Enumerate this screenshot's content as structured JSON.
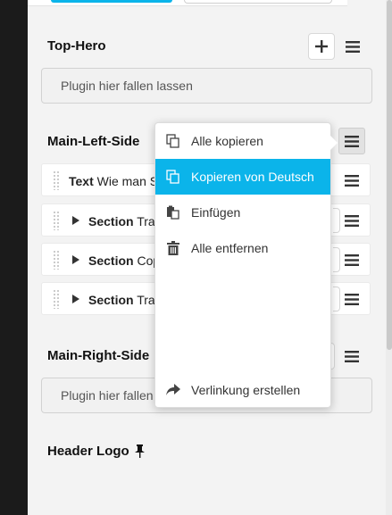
{
  "placeholders": {
    "items": []
  },
  "sections": {
    "top_hero": {
      "title": "Top-Hero",
      "dropzone": "Plugin hier fallen lassen"
    },
    "main_left": {
      "title": "Main-Left-Side",
      "rows": [
        {
          "type": "Text",
          "text": "Wie man S"
        },
        {
          "type": "Section",
          "text": "Tra"
        },
        {
          "type": "Section",
          "text": "Cop"
        },
        {
          "type": "Section",
          "text": "Tra"
        }
      ]
    },
    "main_right": {
      "title": "Main-Right-Side",
      "dropzone": "Plugin hier fallen"
    },
    "header_logo": {
      "title": "Header Logo"
    }
  },
  "dropdown": {
    "items": [
      {
        "label": "Alle kopieren",
        "icon": "copy-icon",
        "highlighted": false
      },
      {
        "label": "Kopieren von Deutsch",
        "icon": "copy-icon",
        "highlighted": true
      },
      {
        "label": "Einfügen",
        "icon": "paste-icon",
        "highlighted": false
      },
      {
        "label": "Alle entfernen",
        "icon": "trash-icon",
        "highlighted": false
      },
      {
        "label": "Verlinkung erstellen",
        "icon": "share-arrow-icon",
        "highlighted": false
      }
    ]
  },
  "colors": {
    "accent": "#0bb4ea",
    "sidebar": "#1b1b1b",
    "panel": "#f3f3f3"
  }
}
